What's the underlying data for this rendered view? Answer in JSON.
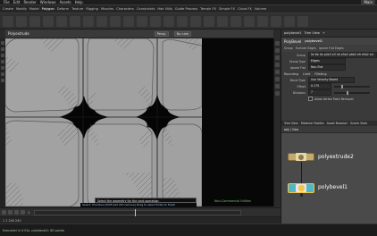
{
  "menubar": {
    "items": [
      "File",
      "Edit",
      "Render",
      "Windows",
      "Assets",
      "Help"
    ],
    "layout_label": "Main"
  },
  "shelf": {
    "tabs": [
      "Create",
      "Modify",
      "Model",
      "Polygon",
      "Deform",
      "Texture",
      "Rigging",
      "Muscles",
      "Characters",
      "Constraints",
      "Hair Utils",
      "Guide Process",
      "Terrain FX",
      "Simple FX",
      "Cloud FX",
      "Volume"
    ]
  },
  "viewport": {
    "title": "Polyextrude",
    "view_mode": "Persp",
    "camera": "No cam",
    "corner_label": "Non-Commercial Edition",
    "tooltip": "Select the geometry for the next operation",
    "hud": "Select: Primitive (Shift:add  Ctrl:remove)  Drag to select  Enter to finish"
  },
  "timeline": {
    "frame": "1",
    "start": "1",
    "end": "240"
  },
  "status": {
    "message": "Executed in 0.01s.  polybevel1: 80 points",
    "range_label": "1   1   240   240"
  },
  "parameters": {
    "tabs": [
      "polybevel1",
      "Tree View",
      "+"
    ],
    "node_type": "PolyBevel",
    "node_name": "polybevel1",
    "filter": [
      "Group",
      "Exclude Edges",
      "Ignore Flat Edges"
    ],
    "rows": [
      {
        "label": "Group",
        "value": "5e 6e 0e p4e3 e3 4e e5e2 p6e2 e9 e5e2 e4"
      },
      {
        "label": "Group Type",
        "value": "Edges"
      },
      {
        "label": "Ignore Flat",
        "value": "Non-Flat"
      },
      {
        "label": "Bevel Type",
        "value": "Use Velocity Based"
      },
      {
        "label": "Offset",
        "value": "0.175"
      },
      {
        "label": "Divisions",
        "value": "7"
      }
    ],
    "sections": [
      "Rounding",
      "Limit",
      "Filleting"
    ],
    "checkbox_label": "Allow Vertex Point Removal"
  },
  "network": {
    "tabs": [
      "Tree View",
      "Material Palette",
      "Asset Browser",
      "Scene View"
    ],
    "path": "obj / Geo",
    "nodes": [
      {
        "name": "polyextrude2",
        "color": "#c3a96b"
      },
      {
        "name": "polybevel1",
        "color": "#4fb7c9"
      }
    ]
  },
  "colors": {
    "mesh_fill": "#9e9e9e",
    "mesh_line": "#5a5a5a",
    "background_dark": "#070707",
    "highlight": "#f6c444",
    "node_blue": "#4fb7c9"
  }
}
